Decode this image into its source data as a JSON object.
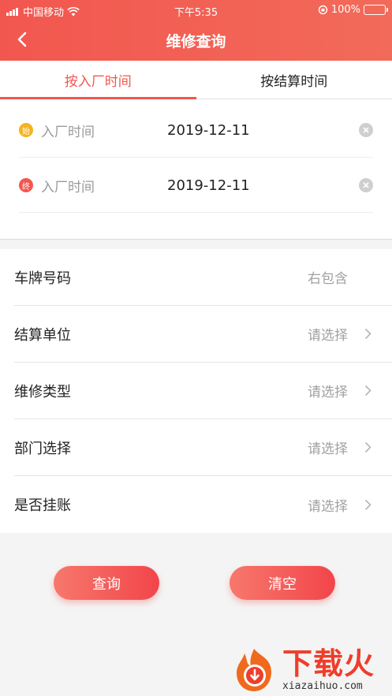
{
  "status_bar": {
    "carrier": "中国移动",
    "time": "下午5:35",
    "battery": "100%"
  },
  "nav": {
    "title": "维修查询"
  },
  "tabs": [
    {
      "label": "按入厂时间",
      "active": true
    },
    {
      "label": "按结算时间",
      "active": false
    }
  ],
  "date_range": {
    "start": {
      "badge": "始",
      "label": "入厂时间",
      "value": "2019-12-11"
    },
    "end": {
      "badge": "终",
      "label": "入厂时间",
      "value": "2019-12-11"
    }
  },
  "form": {
    "plate": {
      "label": "车牌号码",
      "placeholder": "右包含"
    },
    "settlement_unit": {
      "label": "结算单位",
      "value": "请选择"
    },
    "repair_type": {
      "label": "维修类型",
      "value": "请选择"
    },
    "department": {
      "label": "部门选择",
      "value": "请选择"
    },
    "on_account": {
      "label": "是否挂账",
      "value": "请选择"
    }
  },
  "buttons": {
    "query": "查询",
    "clear": "清空"
  },
  "watermark": {
    "main": "下载火",
    "sub": "xiazaihuo.com"
  },
  "colors": {
    "accent": "#f2574f",
    "start_badge": "#f5b31e"
  }
}
